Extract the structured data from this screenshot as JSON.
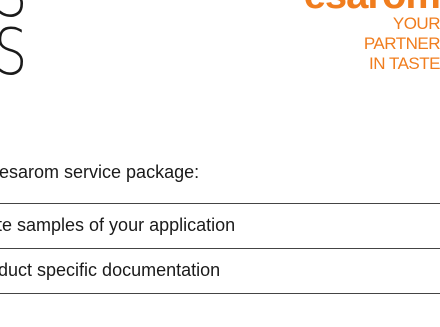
{
  "hero": {
    "lines": [
      "S",
      "S"
    ]
  },
  "logo": {
    "word": "esarom",
    "tagline": [
      "YOUR",
      "PARTNER",
      "IN TASTE"
    ],
    "color": "#f07d1e"
  },
  "intro": {
    "text": "e esarom service package:"
  },
  "services": {
    "items": [
      {
        "label": "ste samples of your application"
      },
      {
        "label": "oduct specific documentation"
      }
    ]
  }
}
